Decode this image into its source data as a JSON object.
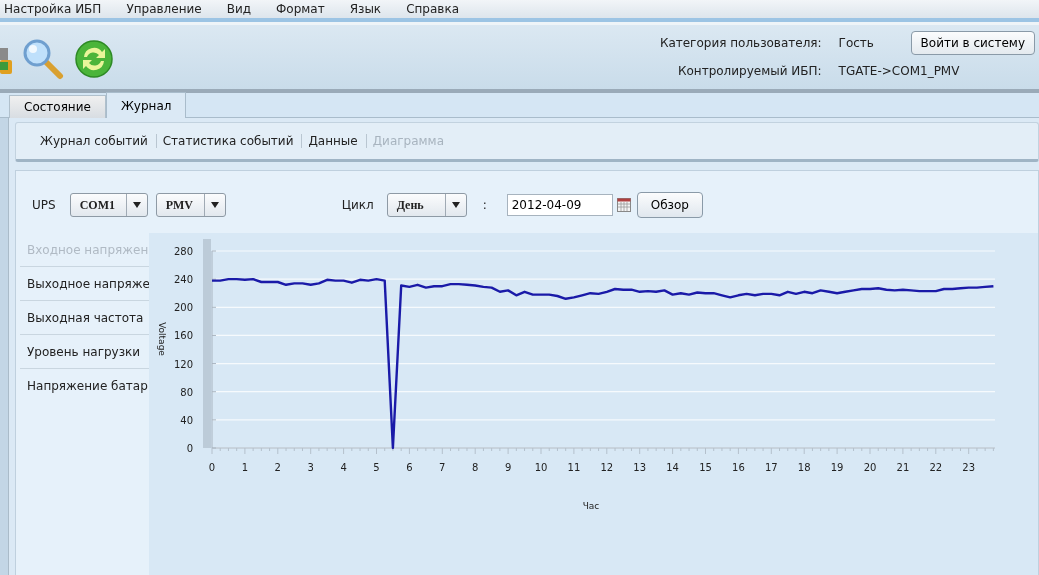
{
  "menu": [
    "Настройка ИБП",
    "Управление",
    "Вид",
    "Формат",
    "Язык",
    "Справка"
  ],
  "user_info": {
    "category_label": "Категория пользователя:",
    "category_value": "Гость",
    "ups_label": "Контролируемый ИБП:",
    "ups_value": "TGATE->COM1_PMV",
    "login_button": "Войти в систему"
  },
  "tabs": [
    {
      "label": "Состояние",
      "selected": false
    },
    {
      "label": "Журнал",
      "selected": true
    }
  ],
  "subnav": [
    {
      "label": "Журнал событий",
      "selected": false
    },
    {
      "label": "Статистика событий",
      "selected": false
    },
    {
      "label": "Данные",
      "selected": false
    },
    {
      "label": "Диаграмма",
      "selected": true
    }
  ],
  "filters": {
    "ups_label": "UPS",
    "port": "COM1",
    "device": "PMV",
    "cycle_label": "Цикл",
    "cycle": "День",
    "separator": ":",
    "date": "2012-04-09",
    "browse_button": "Обзор"
  },
  "parameters": [
    {
      "label": "Входное напряжен",
      "selected": true
    },
    {
      "label": "Выходное напряже",
      "selected": false
    },
    {
      "label": "Выходная частота",
      "selected": false
    },
    {
      "label": "Уровень нагрузки",
      "selected": false
    },
    {
      "label": "Напряжение батар",
      "selected": false
    }
  ],
  "chart": {
    "chart_data": {
      "type": "line",
      "xlabel": "Час",
      "ylabel": "Voltage",
      "xlim": [
        0,
        23.8
      ],
      "ylim": [
        0,
        280
      ],
      "xticks": [
        0,
        1,
        2,
        3,
        4,
        5,
        6,
        7,
        8,
        9,
        10,
        11,
        12,
        13,
        14,
        15,
        16,
        17,
        18,
        19,
        20,
        21,
        22,
        23
      ],
      "yticks": [
        0,
        40,
        80,
        120,
        160,
        200,
        240,
        280
      ],
      "x": [
        0,
        0.25,
        0.5,
        0.75,
        1,
        1.25,
        1.5,
        1.75,
        2,
        2.25,
        2.5,
        2.75,
        3,
        3.25,
        3.5,
        3.75,
        4,
        4.25,
        4.5,
        4.75,
        5,
        5.25,
        5.5,
        5.75,
        6,
        6.25,
        6.5,
        6.75,
        7,
        7.25,
        7.5,
        7.75,
        8,
        8.25,
        8.5,
        8.75,
        9,
        9.25,
        9.5,
        9.75,
        10,
        10.25,
        10.5,
        10.75,
        11,
        11.25,
        11.5,
        11.75,
        12,
        12.25,
        12.5,
        12.75,
        13,
        13.25,
        13.5,
        13.75,
        14,
        14.25,
        14.5,
        14.75,
        15,
        15.25,
        15.5,
        15.75,
        16,
        16.25,
        16.5,
        16.75,
        17,
        17.25,
        17.5,
        17.75,
        18,
        18.25,
        18.5,
        18.75,
        19,
        19.25,
        19.5,
        19.75,
        20,
        20.25,
        20.5,
        20.75,
        21,
        21.25,
        21.5,
        21.75,
        22,
        22.25,
        22.5,
        22.75,
        23,
        23.25,
        23.5,
        23.75
      ],
      "grid": true,
      "series": [
        {
          "color": "#1a1aa8",
          "values": [
            238,
            238,
            240,
            240,
            239,
            240,
            236,
            236,
            236,
            232,
            234,
            234,
            232,
            234,
            239,
            238,
            238,
            235,
            239,
            238,
            240,
            238,
            0,
            231,
            229,
            232,
            228,
            230,
            230,
            233,
            233,
            232,
            231,
            229,
            228,
            222,
            224,
            217,
            222,
            218,
            218,
            218,
            216,
            212,
            214,
            217,
            220,
            219,
            222,
            226,
            225,
            225,
            222,
            223,
            222,
            224,
            218,
            220,
            218,
            221,
            220,
            220,
            217,
            214,
            217,
            219,
            217,
            219,
            219,
            217,
            222,
            219,
            222,
            220,
            224,
            222,
            220,
            222,
            224,
            226,
            226,
            227,
            225,
            224,
            225,
            224,
            223,
            223,
            223,
            226,
            226,
            227,
            228,
            228,
            229,
            230
          ]
        }
      ]
    }
  }
}
